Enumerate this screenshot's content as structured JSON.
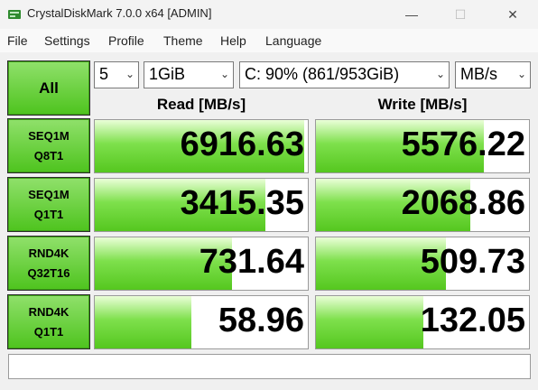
{
  "window": {
    "title": "CrystalDiskMark 7.0.0 x64 [ADMIN]"
  },
  "menu": [
    "File",
    "Settings",
    "Profile",
    "Theme",
    "Help",
    "Language"
  ],
  "controls": {
    "all_label": "All",
    "count": "5",
    "size": "1GiB",
    "drive": "C: 90% (861/953GiB)",
    "unit": "MB/s"
  },
  "headers": {
    "read": "Read [MB/s]",
    "write": "Write [MB/s]"
  },
  "tests": [
    {
      "line1": "SEQ1M",
      "line2": "Q8T1",
      "read": "6916.63",
      "write": "5576.22",
      "read_level": 0.985,
      "write_level": 0.79
    },
    {
      "line1": "SEQ1M",
      "line2": "Q1T1",
      "read": "3415.35",
      "write": "2068.86",
      "read_level": 0.8,
      "write_level": 0.725
    },
    {
      "line1": "RND4K",
      "line2": "Q32T16",
      "read": "731.64",
      "write": "509.73",
      "read_level": 0.645,
      "write_level": 0.61
    },
    {
      "line1": "RND4K",
      "line2": "Q1T1",
      "read": "58.96",
      "write": "132.05",
      "read_level": 0.455,
      "write_level": 0.505
    }
  ],
  "status": ""
}
